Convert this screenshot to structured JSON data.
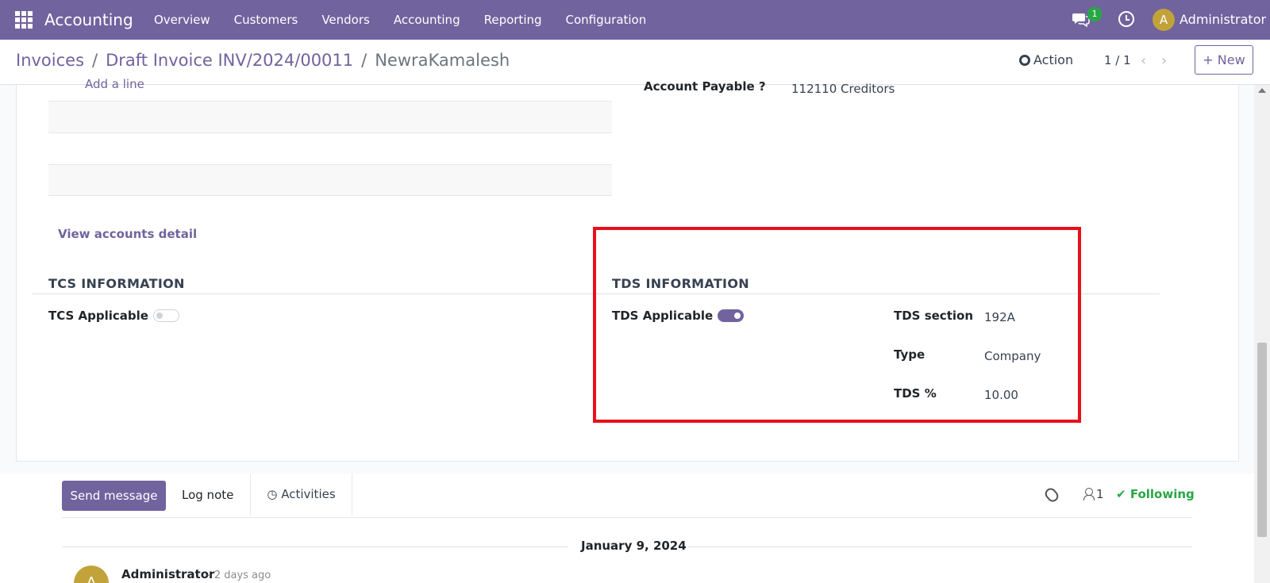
{
  "navbar": {
    "brand": "Accounting",
    "menu": [
      "Overview",
      "Customers",
      "Vendors",
      "Accounting",
      "Reporting",
      "Configuration"
    ],
    "chat_badge": "1",
    "avatar_initial": "A",
    "user_name": "Administrator",
    "bg_color": "#71639e"
  },
  "control": {
    "breadcrumb": {
      "first": "Invoices",
      "second": "Draft Invoice INV/2024/00011",
      "current": "NewraKamalesh",
      "separator": "/"
    },
    "action_label": "Action",
    "pager": "1 / 1",
    "new_label": "New"
  },
  "form": {
    "add_line": "Add a line",
    "account_payable_label": "Account Payable ?",
    "account_payable_value": "112110 Creditors",
    "view_accounts": "View accounts detail",
    "tcs": {
      "title": "TCS INFORMATION",
      "applicable_label": "TCS Applicable",
      "applicable": false
    },
    "tds": {
      "title": "TDS INFORMATION",
      "applicable_label": "TDS Applicable",
      "applicable": true,
      "section_label": "TDS section",
      "section_value": "192A",
      "type_label": "Type",
      "type_value": "Company",
      "percent_label": "TDS %",
      "percent_value": "10.00"
    },
    "highlight_color": "#e8101a"
  },
  "chatter": {
    "send_message": "Send message",
    "log_note": "Log note",
    "activities": "Activities",
    "followers_count": "1",
    "following": "Following",
    "date_separator": "January 9, 2024",
    "message": {
      "avatar_initial": "A",
      "author": "Administrator",
      "time": "- 2 days ago"
    }
  }
}
